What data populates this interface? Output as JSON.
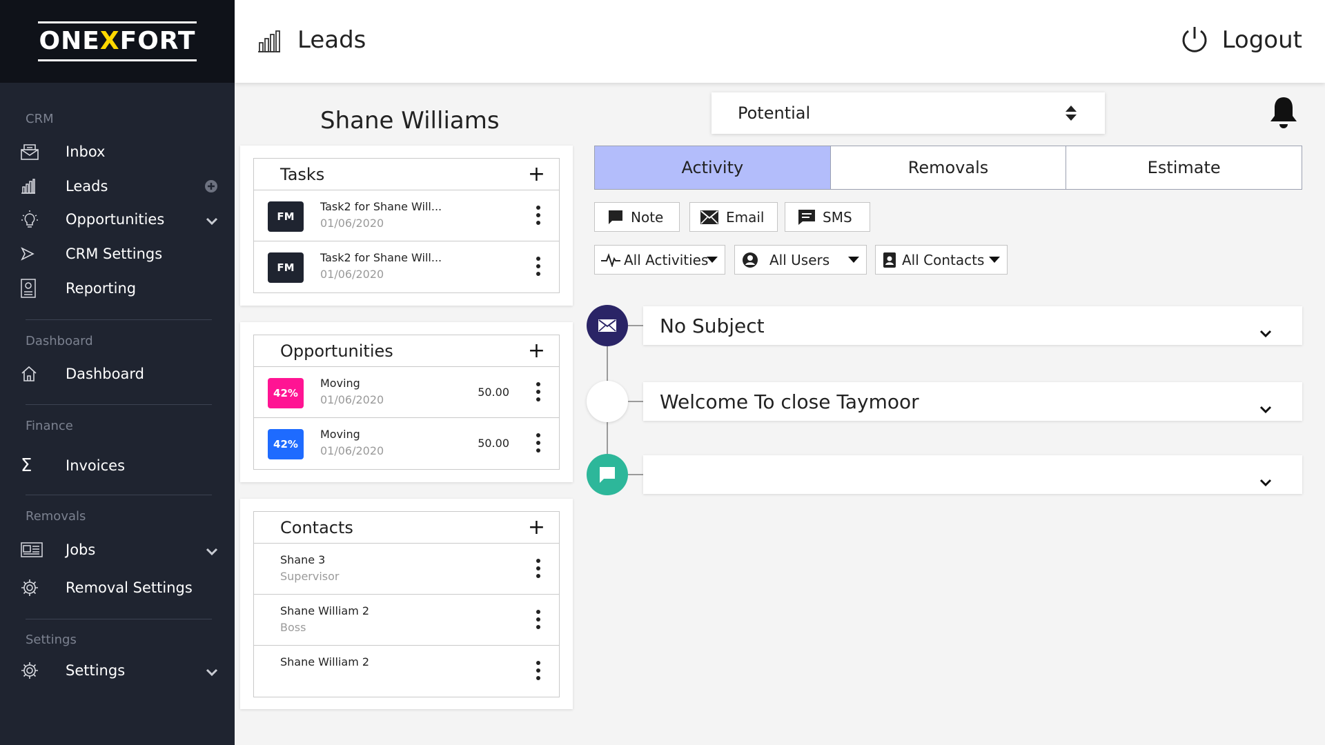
{
  "logo": {
    "prefix": "ONE",
    "x": "X",
    "suffix": "FORT"
  },
  "header": {
    "title": "Leads",
    "logout": "Logout"
  },
  "sidebar": {
    "sections": [
      {
        "label": "CRM"
      },
      {
        "label": "Dashboard"
      },
      {
        "label": "Finance"
      },
      {
        "label": "Removals"
      },
      {
        "label": "Settings"
      }
    ],
    "items": [
      {
        "label": "Inbox",
        "icon": "inbox-icon"
      },
      {
        "label": "Leads",
        "icon": "chart-icon"
      },
      {
        "label": "Opportunities",
        "icon": "lightbulb-icon"
      },
      {
        "label": "CRM Settings",
        "icon": "send-icon"
      },
      {
        "label": "Reporting",
        "icon": "report-icon"
      },
      {
        "label": "Dashboard",
        "icon": "home-icon"
      },
      {
        "label": "Invoices",
        "icon": "sigma-icon"
      },
      {
        "label": "Jobs",
        "icon": "jobs-icon"
      },
      {
        "label": "Removal Settings",
        "icon": "gear-icon"
      },
      {
        "label": "Settings",
        "icon": "gear-icon"
      }
    ]
  },
  "person": {
    "name": "Shane Williams"
  },
  "tasks": {
    "title": "Tasks",
    "rows": [
      {
        "badge": "FM",
        "title": "Task2 for Shane Will...",
        "date": "01/06/2020"
      },
      {
        "badge": "FM",
        "title": "Task2 for Shane Will...",
        "date": "01/06/2020"
      }
    ]
  },
  "opportunities": {
    "title": "Opportunities",
    "rows": [
      {
        "badge": "42%",
        "title": "Moving",
        "date": "01/06/2020",
        "amount": "50.00",
        "color": "#ff1493"
      },
      {
        "badge": "42%",
        "title": "Moving",
        "date": "01/06/2020",
        "amount": "50.00",
        "color": "#1e6bff"
      }
    ]
  },
  "contacts": {
    "title": "Contacts",
    "rows": [
      {
        "name": "Shane 3",
        "role": "Supervisor"
      },
      {
        "name": "Shane William 2",
        "role": "Boss"
      },
      {
        "name": "Shane William 2",
        "role": ""
      }
    ]
  },
  "status": {
    "value": "Potential"
  },
  "tabs": [
    {
      "label": "Activity",
      "active": true
    },
    {
      "label": "Removals",
      "active": false
    },
    {
      "label": "Estimate",
      "active": false
    }
  ],
  "actions": {
    "note": "Note",
    "email": "Email",
    "sms": "SMS"
  },
  "filters": {
    "activities": "All Activities",
    "users": "All Users",
    "contacts": "All Contacts"
  },
  "timeline": [
    {
      "subject": "No Subject",
      "icon": "envelope-icon",
      "color": "#2a2466"
    },
    {
      "subject": "Welcome To close Taymoor",
      "icon": "blank-icon",
      "color": "#ffffff"
    },
    {
      "subject": "",
      "icon": "chat-icon",
      "color": "#2db79a"
    }
  ],
  "colors": {
    "sidebar": "#1f2430",
    "logo_bg": "#0f1219",
    "accent_tab": "#b3bdfb",
    "logo_x": "#ffd800"
  }
}
